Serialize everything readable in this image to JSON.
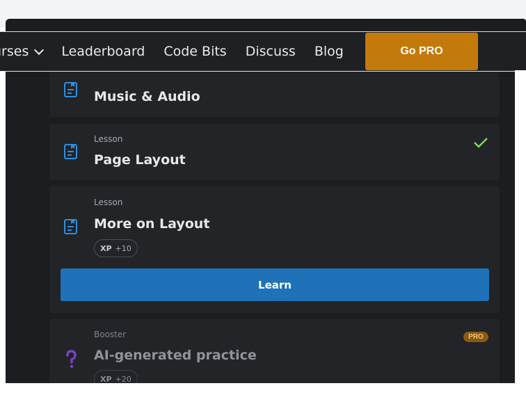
{
  "nav": {
    "items": [
      {
        "label": "urses",
        "has_dropdown": true
      },
      {
        "label": "Leaderboard"
      },
      {
        "label": "Code Bits"
      },
      {
        "label": "Discuss"
      },
      {
        "label": "Blog"
      }
    ],
    "cta_label": "Go PRO"
  },
  "cards": [
    {
      "kind": "",
      "title": "Music & Audio",
      "icon": "lesson-doc-icon"
    },
    {
      "kind": "Lesson",
      "title": "Page Layout",
      "icon": "lesson-doc-icon",
      "completed": true
    },
    {
      "kind": "Lesson",
      "title": "More on Layout",
      "icon": "lesson-doc-icon",
      "xp_label": "XP",
      "xp_value": "+10",
      "button_label": "Learn"
    },
    {
      "kind": "Booster",
      "title": "AI-generated practice",
      "icon": "question-mark-icon",
      "badge": "PRO",
      "xp_label": "XP",
      "xp_value": "+20"
    }
  ],
  "colors": {
    "background": "#1b1d20",
    "card": "#222427",
    "accent_blue": "#1f72b8",
    "pro_orange": "#c47a0a",
    "check_green": "#7ed957"
  }
}
